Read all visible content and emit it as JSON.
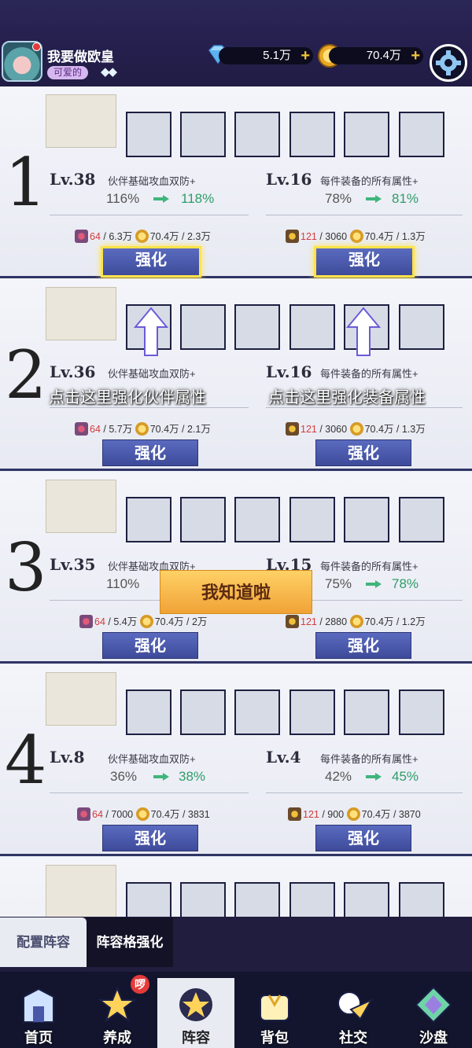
{
  "header": {
    "username": "我要做欧皇",
    "title_badge": "可爱的",
    "diamonds": "5.1万",
    "coins": "70.4万"
  },
  "rows": [
    {
      "num": "1",
      "left": {
        "lv": "Lv.38",
        "desc": "伙伴基础攻血双防+",
        "old": "116%",
        "new": "118%",
        "cost_a": "64",
        "cost_a_total": " / 6.3万",
        "cost_b": "70.4万",
        "cost_b_total": " / 2.3万"
      },
      "right": {
        "lv": "Lv.16",
        "desc": "每件装备的所有属性+",
        "old": "78%",
        "new": "81%",
        "cost_a": "121",
        "cost_a_total": " / 3060",
        "cost_b": "70.4万",
        "cost_b_total": " / 1.3万"
      },
      "btn": "强化"
    },
    {
      "num": "2",
      "left": {
        "lv": "Lv.36",
        "desc": "伙伴基础攻血双防+",
        "old": "",
        "new": "",
        "cost_a": "64",
        "cost_a_total": " / 5.7万",
        "cost_b": "70.4万",
        "cost_b_total": " / 2.1万"
      },
      "right": {
        "lv": "Lv.16",
        "desc": "每件装备的所有属性+",
        "old": "",
        "new": "",
        "cost_a": "121",
        "cost_a_total": " / 3060",
        "cost_b": "70.4万",
        "cost_b_total": " / 1.3万"
      },
      "btn": "强化"
    },
    {
      "num": "3",
      "left": {
        "lv": "Lv.35",
        "desc": "伙伴基础攻血双防+",
        "old": "110%",
        "new": "",
        "cost_a": "64",
        "cost_a_total": " / 5.4万",
        "cost_b": "70.4万",
        "cost_b_total": " / 2万"
      },
      "right": {
        "lv": "Lv.15",
        "desc": "每件装备的所有属性+",
        "old": "75%",
        "new": "78%",
        "cost_a": "121",
        "cost_a_total": " / 2880",
        "cost_b": "70.4万",
        "cost_b_total": " / 1.2万"
      },
      "btn": "强化"
    },
    {
      "num": "4",
      "left": {
        "lv": "Lv.8",
        "desc": "伙伴基础攻血双防+",
        "old": "36%",
        "new": "38%",
        "cost_a": "64",
        "cost_a_total": " / 7000",
        "cost_b": "70.4万",
        "cost_b_total": " / 3831"
      },
      "right": {
        "lv": "Lv.4",
        "desc": "每件装备的所有属性+",
        "old": "42%",
        "new": "45%",
        "cost_a": "121",
        "cost_a_total": " / 900",
        "cost_b": "70.4万",
        "cost_b_total": " / 3870"
      },
      "btn": "强化"
    }
  ],
  "tutorial": {
    "tip_left": "点击这里强化伙伴属性",
    "tip_right": "点击这里强化装备属性",
    "confirm": "我知道啦"
  },
  "subtabs": {
    "configure": "配置阵容",
    "grid_strengthen": "阵容格强化"
  },
  "nav": {
    "home": "首页",
    "train": "养成",
    "train_badge": "啰",
    "lineup": "阵容",
    "bag": "背包",
    "social": "社交",
    "sandbox": "沙盘"
  },
  "colors": {
    "accent": "#ffe34a",
    "button": "#4a58a8",
    "increase": "#2e9d68",
    "cost_red": "#d43b3b"
  }
}
